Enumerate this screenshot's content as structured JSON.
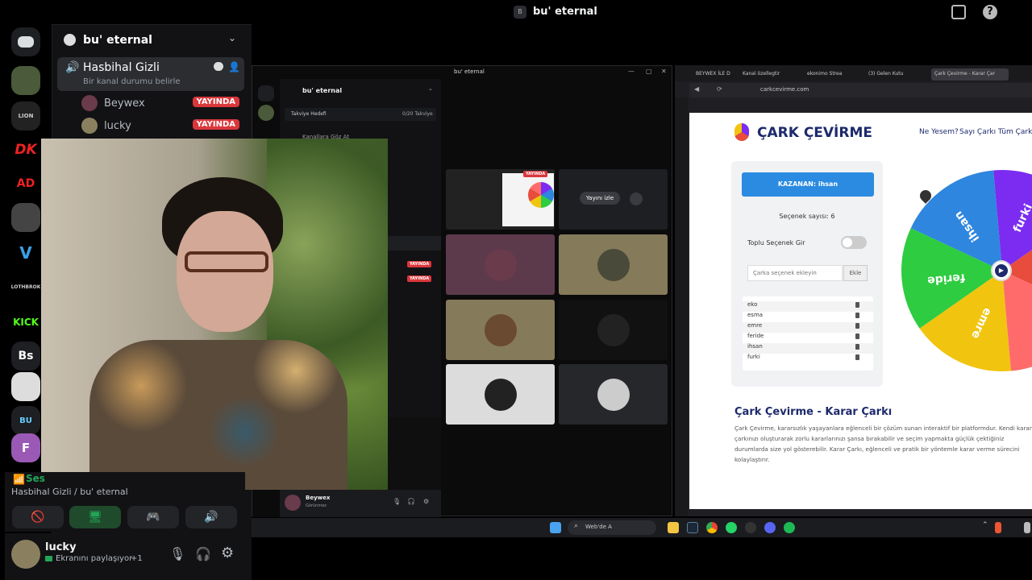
{
  "topbar": {
    "title": "bu' eternal"
  },
  "rail": {
    "servers": [
      {
        "name": "discord-home",
        "label": "",
        "color": "#1e1f22"
      },
      {
        "name": "server-portrait",
        "label": "",
        "color": "#4a5a3a"
      },
      {
        "name": "server-lion",
        "label": "LION",
        "color": "#222"
      },
      {
        "name": "server-dk",
        "label": "DK",
        "color": "#000"
      },
      {
        "name": "server-ad",
        "label": "AD",
        "color": "#000"
      },
      {
        "name": "server-warrior",
        "label": "",
        "color": "#444"
      },
      {
        "name": "server-v",
        "label": "V",
        "color": "#000"
      },
      {
        "name": "server-lothbrok",
        "label": "LOTHBROK",
        "color": "#000"
      },
      {
        "name": "server-kick",
        "label": "KICK",
        "color": "#000"
      },
      {
        "name": "server-bs",
        "label": "Bs",
        "color": "#1e1f22"
      },
      {
        "name": "server-troll",
        "label": "",
        "color": "#ddd"
      },
      {
        "name": "server-bu",
        "label": "BU",
        "color": "#1e1f22"
      },
      {
        "name": "server-f",
        "label": "F",
        "color": "#9b59b6"
      }
    ]
  },
  "channel": {
    "server_name": "bu' eternal",
    "voice_channel": "Hasbihal Gizli",
    "voice_status": "Bir kanal durumu belirle",
    "users": [
      {
        "name": "Beywex",
        "badge": "YAYINDA"
      },
      {
        "name": "lucky",
        "badge": "YAYINDA"
      }
    ],
    "voice_connected_label": "Ses",
    "voice_location": "Hasbihal Gizli / bu' eternal"
  },
  "user_panel": {
    "name": "lucky",
    "status": "Ekranını paylaşıyor",
    "status_extra": "+1"
  },
  "win2": {
    "title": "bu' eternal",
    "server_name": "bu' eternal",
    "boost_label": "Takviye Hedefi",
    "boost_value": "0/20 Takviye",
    "invite_label": "Kanallara Göz At",
    "live1": "YAYINDA",
    "live2": "YAYINDA",
    "watch_btn": "Yayını izle",
    "tile_live": "YAYINDA",
    "user_name": "Beywex",
    "user_status": "Görünmez"
  },
  "browser": {
    "tabs": [
      "BEYWEX İLE D",
      "Kanal özellegtir",
      "ekonimo Strea",
      "(3) Gelen Kutu",
      "Çark Çevirme - Karar Çar"
    ],
    "url": "carkcevirme.com",
    "logo": "ÇARK ÇEVİRME",
    "nav": [
      "Ne Yesem?",
      "Sayı Çarkı",
      "Tüm Çarkla"
    ],
    "winner": "KAZANAN: ihsan",
    "option_count": "Seçenek sayısı: 6",
    "bulk_label": "Toplu Seçenek Gir",
    "input_placeholder": "Çarka seçenek ekleyin",
    "add_btn": "Ekle",
    "options": [
      "eko",
      "esma",
      "emre",
      "feride",
      "ihsan",
      "furki"
    ],
    "heading": "Çark Çevirme - Karar Çarkı",
    "paragraph": "Çark Çevirme, kararsızlık yaşayanlara eğlenceli bir çözüm sunan interaktif bir platformdur. Kendi karar çarkınızı oluşturarak zorlu kararlarınızı şansa bırakabilir ve seçim yapmakta güçlük çektiğiniz durumlarda size yol gösterebilir. Karar Çarkı, eğlenceli ve pratik bir yöntemle karar verme sürecini kolaylaştırır.",
    "wheel_labels": [
      "furki",
      "ihsan",
      "feride",
      "emre"
    ]
  },
  "taskbar": {
    "search": "Web'de A"
  },
  "colors": {
    "live_red": "#da373c",
    "brand_blue": "#2a8be0",
    "wheel": [
      "#7b2cf0",
      "#2e86de",
      "#2ecc40",
      "#f1c40f",
      "#e74c3c",
      "#ff6b6b"
    ]
  }
}
